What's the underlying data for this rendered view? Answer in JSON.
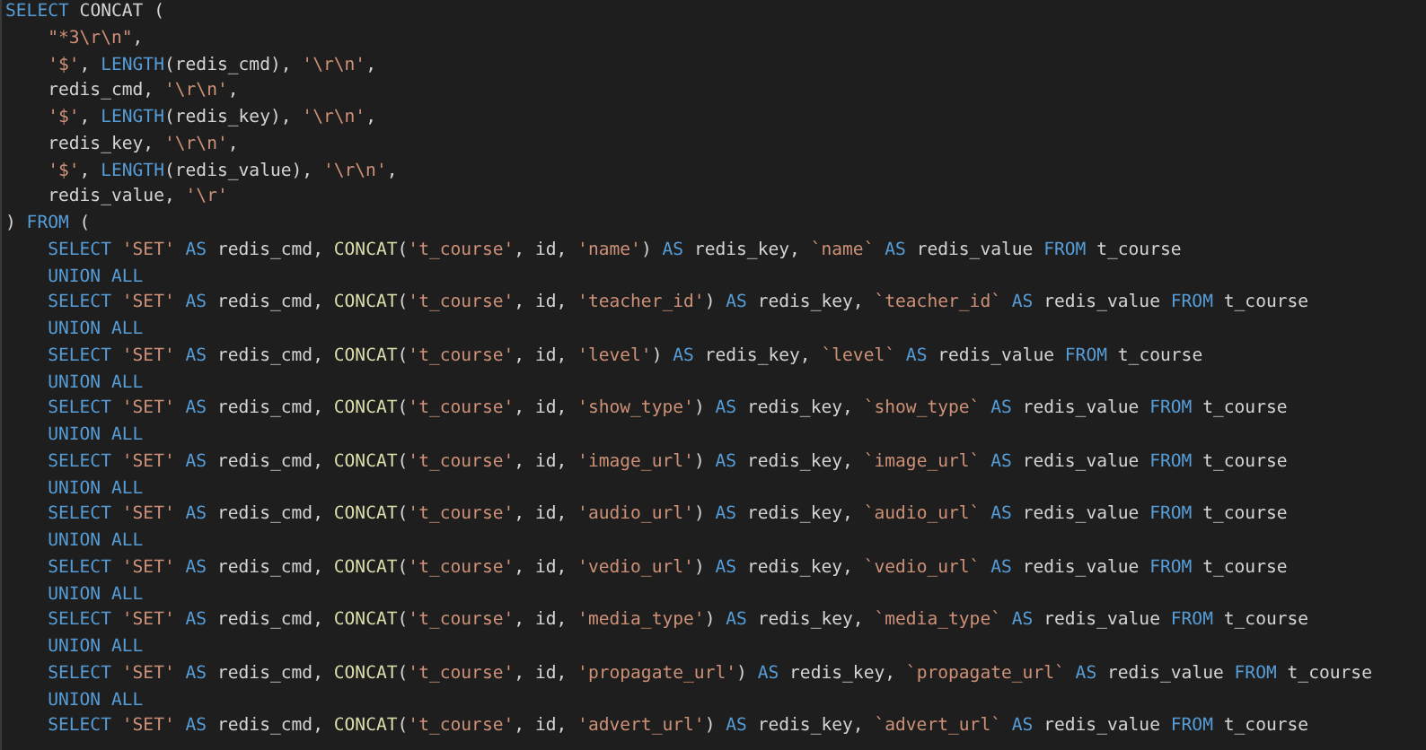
{
  "editor": {
    "lines": [
      [
        {
          "kind": "kw",
          "text": "SELECT "
        },
        {
          "kind": "plain",
          "text": "CONCAT ("
        }
      ],
      [
        {
          "kind": "str",
          "text": "    \"*3\\r\\n\""
        },
        {
          "kind": "plain",
          "text": ","
        }
      ],
      [
        {
          "kind": "str",
          "text": "    '$'"
        },
        {
          "kind": "plain",
          "text": ", "
        },
        {
          "kind": "kw",
          "text": "LENGTH"
        },
        {
          "kind": "plain",
          "text": "(redis_cmd), "
        },
        {
          "kind": "str",
          "text": "'\\r\\n'"
        },
        {
          "kind": "plain",
          "text": ","
        }
      ],
      [
        {
          "kind": "plain",
          "text": "    redis_cmd, "
        },
        {
          "kind": "str",
          "text": "'\\r\\n'"
        },
        {
          "kind": "plain",
          "text": ","
        }
      ],
      [
        {
          "kind": "str",
          "text": "    '$'"
        },
        {
          "kind": "plain",
          "text": ", "
        },
        {
          "kind": "kw",
          "text": "LENGTH"
        },
        {
          "kind": "plain",
          "text": "(redis_key), "
        },
        {
          "kind": "str",
          "text": "'\\r\\n'"
        },
        {
          "kind": "plain",
          "text": ","
        }
      ],
      [
        {
          "kind": "plain",
          "text": "    redis_key, "
        },
        {
          "kind": "str",
          "text": "'\\r\\n'"
        },
        {
          "kind": "plain",
          "text": ","
        }
      ],
      [
        {
          "kind": "str",
          "text": "    '$'"
        },
        {
          "kind": "plain",
          "text": ", "
        },
        {
          "kind": "kw",
          "text": "LENGTH"
        },
        {
          "kind": "plain",
          "text": "(redis_value), "
        },
        {
          "kind": "str",
          "text": "'\\r\\n'"
        },
        {
          "kind": "plain",
          "text": ","
        }
      ],
      [
        {
          "kind": "plain",
          "text": "    redis_value, "
        },
        {
          "kind": "str",
          "text": "'\\r'"
        }
      ],
      [
        {
          "kind": "plain",
          "text": ") "
        },
        {
          "kind": "kw",
          "text": "FROM"
        },
        {
          "kind": "plain",
          "text": " ("
        }
      ],
      [
        {
          "kind": "kw",
          "text": "    SELECT "
        },
        {
          "kind": "str",
          "text": "'SET'"
        },
        {
          "kind": "kw",
          "text": " AS "
        },
        {
          "kind": "plain",
          "text": "redis_cmd, "
        },
        {
          "kind": "fn",
          "text": "CONCAT"
        },
        {
          "kind": "plain",
          "text": "("
        },
        {
          "kind": "str",
          "text": "'t_course'"
        },
        {
          "kind": "plain",
          "text": ", id, "
        },
        {
          "kind": "str",
          "text": "'name'"
        },
        {
          "kind": "plain",
          "text": ") "
        },
        {
          "kind": "kw",
          "text": "AS "
        },
        {
          "kind": "plain",
          "text": "redis_key, "
        },
        {
          "kind": "str",
          "text": "`name`"
        },
        {
          "kind": "kw",
          "text": " AS "
        },
        {
          "kind": "plain",
          "text": "redis_value "
        },
        {
          "kind": "kw",
          "text": "FROM "
        },
        {
          "kind": "plain",
          "text": "t_course"
        }
      ],
      [
        {
          "kind": "kw",
          "text": "    UNION ALL"
        }
      ],
      [
        {
          "kind": "kw",
          "text": "    SELECT "
        },
        {
          "kind": "str",
          "text": "'SET'"
        },
        {
          "kind": "kw",
          "text": " AS "
        },
        {
          "kind": "plain",
          "text": "redis_cmd, "
        },
        {
          "kind": "fn",
          "text": "CONCAT"
        },
        {
          "kind": "plain",
          "text": "("
        },
        {
          "kind": "str",
          "text": "'t_course'"
        },
        {
          "kind": "plain",
          "text": ", id, "
        },
        {
          "kind": "str",
          "text": "'teacher_id'"
        },
        {
          "kind": "plain",
          "text": ") "
        },
        {
          "kind": "kw",
          "text": "AS "
        },
        {
          "kind": "plain",
          "text": "redis_key, "
        },
        {
          "kind": "str",
          "text": "`teacher_id`"
        },
        {
          "kind": "kw",
          "text": " AS "
        },
        {
          "kind": "plain",
          "text": "redis_value "
        },
        {
          "kind": "kw",
          "text": "FROM "
        },
        {
          "kind": "plain",
          "text": "t_course"
        }
      ],
      [
        {
          "kind": "kw",
          "text": "    UNION ALL"
        }
      ],
      [
        {
          "kind": "kw",
          "text": "    SELECT "
        },
        {
          "kind": "str",
          "text": "'SET'"
        },
        {
          "kind": "kw",
          "text": " AS "
        },
        {
          "kind": "plain",
          "text": "redis_cmd, "
        },
        {
          "kind": "fn",
          "text": "CONCAT"
        },
        {
          "kind": "plain",
          "text": "("
        },
        {
          "kind": "str",
          "text": "'t_course'"
        },
        {
          "kind": "plain",
          "text": ", id, "
        },
        {
          "kind": "str",
          "text": "'level'"
        },
        {
          "kind": "plain",
          "text": ") "
        },
        {
          "kind": "kw",
          "text": "AS "
        },
        {
          "kind": "plain",
          "text": "redis_key, "
        },
        {
          "kind": "str",
          "text": "`level`"
        },
        {
          "kind": "kw",
          "text": " AS "
        },
        {
          "kind": "plain",
          "text": "redis_value "
        },
        {
          "kind": "kw",
          "text": "FROM "
        },
        {
          "kind": "plain",
          "text": "t_course"
        }
      ],
      [
        {
          "kind": "kw",
          "text": "    UNION ALL"
        }
      ],
      [
        {
          "kind": "kw",
          "text": "    SELECT "
        },
        {
          "kind": "str",
          "text": "'SET'"
        },
        {
          "kind": "kw",
          "text": " AS "
        },
        {
          "kind": "plain",
          "text": "redis_cmd, "
        },
        {
          "kind": "fn",
          "text": "CONCAT"
        },
        {
          "kind": "plain",
          "text": "("
        },
        {
          "kind": "str",
          "text": "'t_course'"
        },
        {
          "kind": "plain",
          "text": ", id, "
        },
        {
          "kind": "str",
          "text": "'show_type'"
        },
        {
          "kind": "plain",
          "text": ") "
        },
        {
          "kind": "kw",
          "text": "AS "
        },
        {
          "kind": "plain",
          "text": "redis_key, "
        },
        {
          "kind": "str",
          "text": "`show_type`"
        },
        {
          "kind": "kw",
          "text": " AS "
        },
        {
          "kind": "plain",
          "text": "redis_value "
        },
        {
          "kind": "kw",
          "text": "FROM "
        },
        {
          "kind": "plain",
          "text": "t_course"
        }
      ],
      [
        {
          "kind": "kw",
          "text": "    UNION ALL"
        }
      ],
      [
        {
          "kind": "kw",
          "text": "    SELECT "
        },
        {
          "kind": "str",
          "text": "'SET'"
        },
        {
          "kind": "kw",
          "text": " AS "
        },
        {
          "kind": "plain",
          "text": "redis_cmd, "
        },
        {
          "kind": "fn",
          "text": "CONCAT"
        },
        {
          "kind": "plain",
          "text": "("
        },
        {
          "kind": "str",
          "text": "'t_course'"
        },
        {
          "kind": "plain",
          "text": ", id, "
        },
        {
          "kind": "str",
          "text": "'image_url'"
        },
        {
          "kind": "plain",
          "text": ") "
        },
        {
          "kind": "kw",
          "text": "AS "
        },
        {
          "kind": "plain",
          "text": "redis_key, "
        },
        {
          "kind": "str",
          "text": "`image_url`"
        },
        {
          "kind": "kw",
          "text": " AS "
        },
        {
          "kind": "plain",
          "text": "redis_value "
        },
        {
          "kind": "kw",
          "text": "FROM "
        },
        {
          "kind": "plain",
          "text": "t_course"
        }
      ],
      [
        {
          "kind": "kw",
          "text": "    UNION ALL"
        }
      ],
      [
        {
          "kind": "kw",
          "text": "    SELECT "
        },
        {
          "kind": "str",
          "text": "'SET'"
        },
        {
          "kind": "kw",
          "text": " AS "
        },
        {
          "kind": "plain",
          "text": "redis_cmd, "
        },
        {
          "kind": "fn",
          "text": "CONCAT"
        },
        {
          "kind": "plain",
          "text": "("
        },
        {
          "kind": "str",
          "text": "'t_course'"
        },
        {
          "kind": "plain",
          "text": ", id, "
        },
        {
          "kind": "str",
          "text": "'audio_url'"
        },
        {
          "kind": "plain",
          "text": ") "
        },
        {
          "kind": "kw",
          "text": "AS "
        },
        {
          "kind": "plain",
          "text": "redis_key, "
        },
        {
          "kind": "str",
          "text": "`audio_url`"
        },
        {
          "kind": "kw",
          "text": " AS "
        },
        {
          "kind": "plain",
          "text": "redis_value "
        },
        {
          "kind": "kw",
          "text": "FROM "
        },
        {
          "kind": "plain",
          "text": "t_course"
        }
      ],
      [
        {
          "kind": "kw",
          "text": "    UNION ALL"
        }
      ],
      [
        {
          "kind": "kw",
          "text": "    SELECT "
        },
        {
          "kind": "str",
          "text": "'SET'"
        },
        {
          "kind": "kw",
          "text": " AS "
        },
        {
          "kind": "plain",
          "text": "redis_cmd, "
        },
        {
          "kind": "fn",
          "text": "CONCAT"
        },
        {
          "kind": "plain",
          "text": "("
        },
        {
          "kind": "str",
          "text": "'t_course'"
        },
        {
          "kind": "plain",
          "text": ", id, "
        },
        {
          "kind": "str",
          "text": "'vedio_url'"
        },
        {
          "kind": "plain",
          "text": ") "
        },
        {
          "kind": "kw",
          "text": "AS "
        },
        {
          "kind": "plain",
          "text": "redis_key, "
        },
        {
          "kind": "str",
          "text": "`vedio_url`"
        },
        {
          "kind": "kw",
          "text": " AS "
        },
        {
          "kind": "plain",
          "text": "redis_value "
        },
        {
          "kind": "kw",
          "text": "FROM "
        },
        {
          "kind": "plain",
          "text": "t_course"
        }
      ],
      [
        {
          "kind": "kw",
          "text": "    UNION ALL"
        }
      ],
      [
        {
          "kind": "kw",
          "text": "    SELECT "
        },
        {
          "kind": "str",
          "text": "'SET'"
        },
        {
          "kind": "kw",
          "text": " AS "
        },
        {
          "kind": "plain",
          "text": "redis_cmd, "
        },
        {
          "kind": "fn",
          "text": "CONCAT"
        },
        {
          "kind": "plain",
          "text": "("
        },
        {
          "kind": "str",
          "text": "'t_course'"
        },
        {
          "kind": "plain",
          "text": ", id, "
        },
        {
          "kind": "str",
          "text": "'media_type'"
        },
        {
          "kind": "plain",
          "text": ") "
        },
        {
          "kind": "kw",
          "text": "AS "
        },
        {
          "kind": "plain",
          "text": "redis_key, "
        },
        {
          "kind": "str",
          "text": "`media_type`"
        },
        {
          "kind": "kw",
          "text": " AS "
        },
        {
          "kind": "plain",
          "text": "redis_value "
        },
        {
          "kind": "kw",
          "text": "FROM "
        },
        {
          "kind": "plain",
          "text": "t_course"
        }
      ],
      [
        {
          "kind": "kw",
          "text": "    UNION ALL"
        }
      ],
      [
        {
          "kind": "kw",
          "text": "    SELECT "
        },
        {
          "kind": "str",
          "text": "'SET'"
        },
        {
          "kind": "kw",
          "text": " AS "
        },
        {
          "kind": "plain",
          "text": "redis_cmd, "
        },
        {
          "kind": "fn",
          "text": "CONCAT"
        },
        {
          "kind": "plain",
          "text": "("
        },
        {
          "kind": "str",
          "text": "'t_course'"
        },
        {
          "kind": "plain",
          "text": ", id, "
        },
        {
          "kind": "str",
          "text": "'propagate_url'"
        },
        {
          "kind": "plain",
          "text": ") "
        },
        {
          "kind": "kw",
          "text": "AS "
        },
        {
          "kind": "plain",
          "text": "redis_key, "
        },
        {
          "kind": "str",
          "text": "`propagate_url`"
        },
        {
          "kind": "kw",
          "text": " AS "
        },
        {
          "kind": "plain",
          "text": "redis_value "
        },
        {
          "kind": "kw",
          "text": "FROM "
        },
        {
          "kind": "plain",
          "text": "t_course"
        }
      ],
      [
        {
          "kind": "kw",
          "text": "    UNION ALL"
        }
      ],
      [
        {
          "kind": "kw",
          "text": "    SELECT "
        },
        {
          "kind": "str",
          "text": "'SET'"
        },
        {
          "kind": "kw",
          "text": " AS "
        },
        {
          "kind": "plain",
          "text": "redis_cmd, "
        },
        {
          "kind": "fn",
          "text": "CONCAT"
        },
        {
          "kind": "plain",
          "text": "("
        },
        {
          "kind": "str",
          "text": "'t_course'"
        },
        {
          "kind": "plain",
          "text": ", id, "
        },
        {
          "kind": "str",
          "text": "'advert_url'"
        },
        {
          "kind": "plain",
          "text": ") "
        },
        {
          "kind": "kw",
          "text": "AS "
        },
        {
          "kind": "plain",
          "text": "redis_key, "
        },
        {
          "kind": "str",
          "text": "`advert_url`"
        },
        {
          "kind": "kw",
          "text": " AS "
        },
        {
          "kind": "plain",
          "text": "redis_value "
        },
        {
          "kind": "kw",
          "text": "FROM "
        },
        {
          "kind": "plain",
          "text": "t_course"
        }
      ]
    ]
  }
}
